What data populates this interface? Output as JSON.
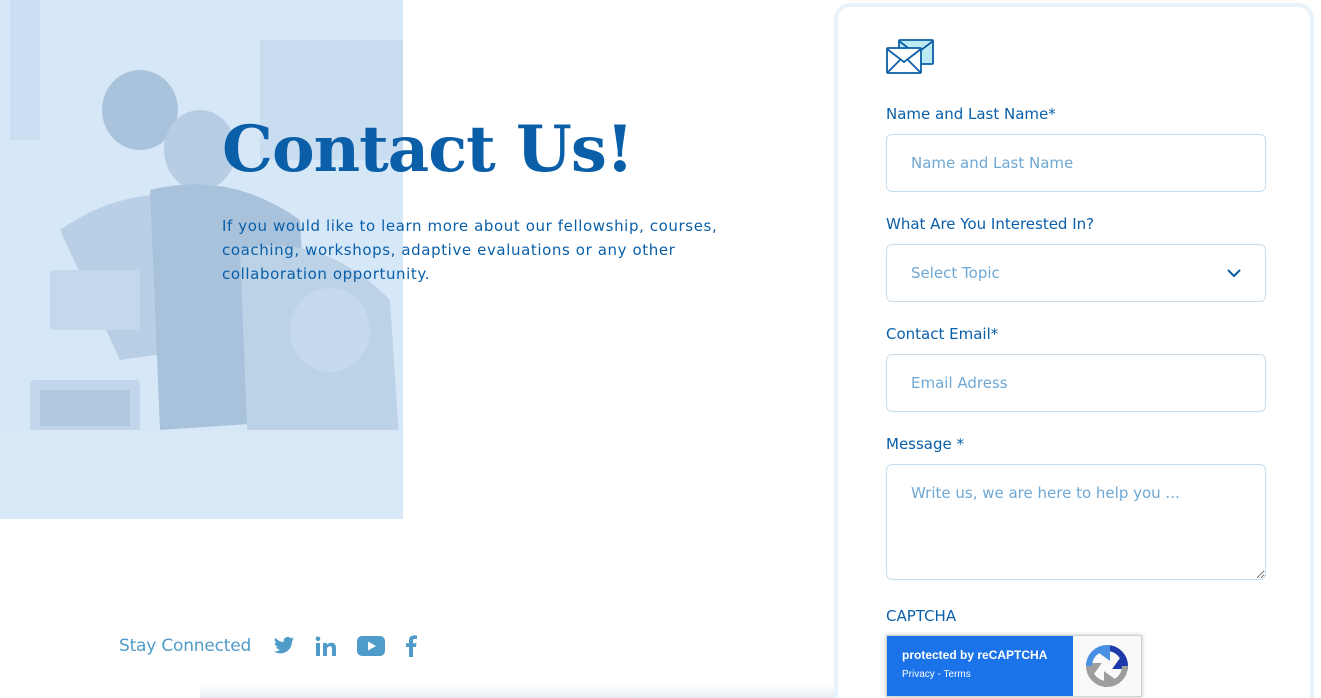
{
  "hero": {
    "title": "Contact Us!",
    "description": "If you would like to learn more about our fellowship, courses, coaching, workshops, adaptive evaluations or any other collaboration opportunity."
  },
  "social": {
    "label": "Stay Connected",
    "icons": [
      "twitter-icon",
      "linkedin-icon",
      "youtube-icon",
      "facebook-icon"
    ]
  },
  "form": {
    "name_label": "Name and Last Name*",
    "name_placeholder": "Name and Last Name",
    "topic_label": "What Are You Interested In?",
    "topic_selected": "Select Topic",
    "email_label": "Contact Email*",
    "email_placeholder": "Email Adress",
    "message_label": "Message *",
    "message_placeholder": "Write us, we are here to help you ...",
    "captcha_label": "CAPTCHA"
  },
  "recaptcha": {
    "main": "protected by reCAPTCHA",
    "privacy": "Privacy",
    "separator": " - ",
    "terms": "Terms"
  },
  "colors": {
    "primary": "#0a5fa8",
    "accent_light": "#4f9bc9",
    "photo_tint": "#d6e7f8",
    "recaptcha_blue": "#1a73e8"
  }
}
